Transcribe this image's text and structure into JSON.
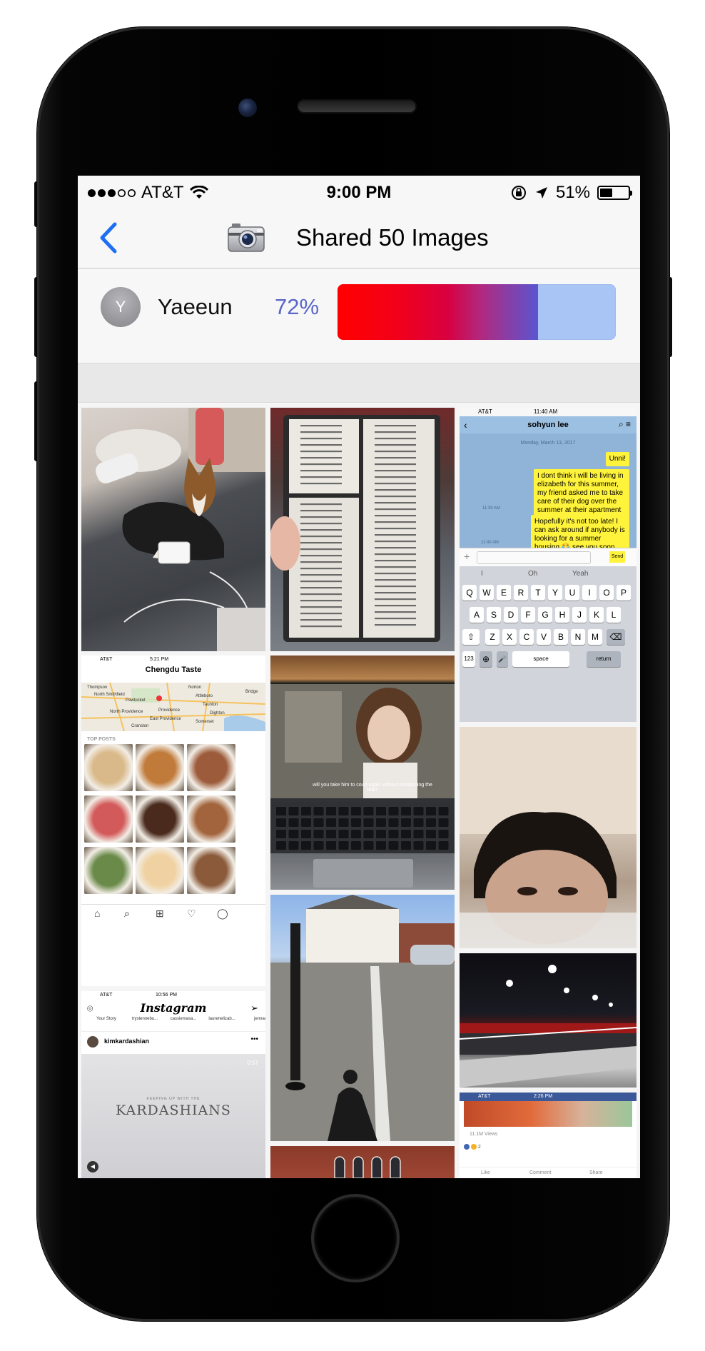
{
  "status_bar": {
    "carrier": "AT&T",
    "time": "9:00 PM",
    "battery_percent": "51%",
    "battery_level": 0.51,
    "signal_bars_filled": 3,
    "signal_bars_total": 5
  },
  "nav": {
    "title": "Shared 50 Images",
    "back_icon": "chevron-left-icon",
    "camera_icon": "camera-icon"
  },
  "user": {
    "initial": "Y",
    "name": "Yaeeun",
    "percent_label": "72%",
    "percent_value": 0.72
  },
  "colors": {
    "accent_blue": "#1e6ef5",
    "percent_text": "#5a66c8",
    "gauge_track": "#a9c5f5",
    "gauge_start": "#ff0000",
    "gauge_end": "#5a55d0"
  },
  "thumbnails": {
    "chat": {
      "status_carrier": "AT&T",
      "status_time": "11:40 AM",
      "contact": "sohyun lee",
      "date": "Monday, March 13, 2017",
      "messages": [
        "Unni!",
        "I dont think i will be living in elizabeth for this summer, my friend asked me to take care of their dog over the summer at their apartment",
        "Hopefully it's not too late! I can ask around if anybody is looking for a summer housing 😂 see you soon"
      ],
      "times": [
        "11:39 AM",
        "11:40 AM"
      ],
      "send_label": "Send",
      "suggestions": [
        "I",
        "Oh",
        "Yeah"
      ],
      "keyboard_rows": [
        [
          "Q",
          "W",
          "E",
          "R",
          "T",
          "Y",
          "U",
          "I",
          "O",
          "P"
        ],
        [
          "A",
          "S",
          "D",
          "F",
          "G",
          "H",
          "J",
          "K",
          "L"
        ],
        [
          "Z",
          "X",
          "C",
          "V",
          "B",
          "N",
          "M"
        ]
      ],
      "key_123": "123",
      "key_space": "space",
      "key_return": "return"
    },
    "chengdu": {
      "status_carrier": "AT&T",
      "status_time": "5:21 PM",
      "title": "Chengdu Taste",
      "map_labels": [
        "Thompson",
        "Norton",
        "North Smithfield",
        "Attleboro",
        "Pawtucket",
        "Taunton",
        "North Providence",
        "Providence",
        "Dighton",
        "East Providence",
        "Somerset",
        "Cranston",
        "Bridge"
      ],
      "top_posts_label": "TOP POSTS"
    },
    "laptop": {
      "subtitle": "will you take him to court again without postponing the trial?"
    },
    "insta": {
      "status_carrier": "AT&T",
      "status_time": "10:56 PM",
      "logo": "Instagram",
      "stories": [
        "Your Story",
        "trystennebu...",
        "cassiemasa...",
        "laurenelizab...",
        "jennac"
      ],
      "account": "kimkardashian",
      "video_time": "0:57",
      "show_small": "KEEPING UP WITH THE",
      "show_title": "KARDASHIANS"
    },
    "kart": {},
    "fb": {
      "status_carrier": "AT&T",
      "status_time": "2:26 PM",
      "views": "11.1M Views",
      "reactions": "2",
      "actions": [
        "Like",
        "Comment",
        "Share"
      ]
    }
  }
}
